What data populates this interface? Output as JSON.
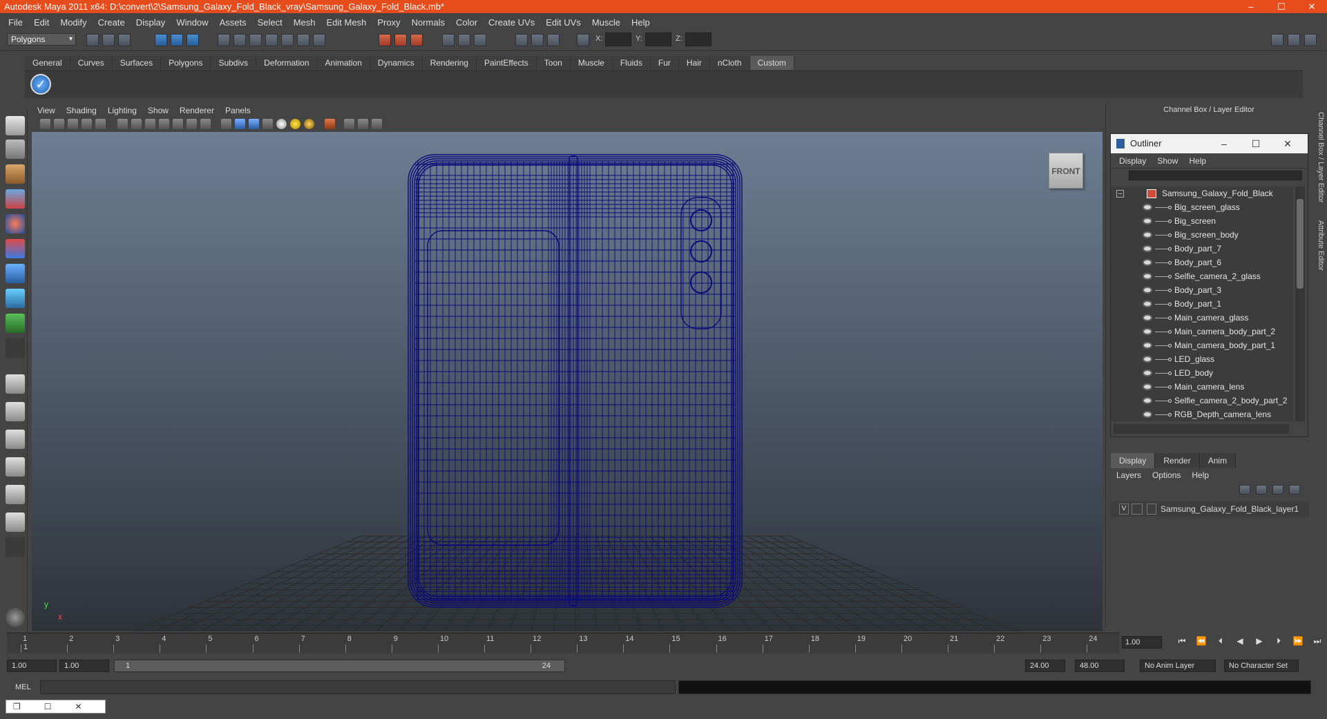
{
  "window": {
    "title": "Autodesk Maya 2011 x64: D:\\convert\\2\\Samsung_Galaxy_Fold_Black_vray\\Samsung_Galaxy_Fold_Black.mb*",
    "controls": [
      "–",
      "☐",
      "✕"
    ]
  },
  "menubar": [
    "File",
    "Edit",
    "Modify",
    "Create",
    "Display",
    "Window",
    "Assets",
    "Select",
    "Mesh",
    "Edit Mesh",
    "Proxy",
    "Normals",
    "Color",
    "Create UVs",
    "Edit UVs",
    "Muscle",
    "Help"
  ],
  "status": {
    "mode": "Polygons",
    "x_label": "X:",
    "y_label": "Y:",
    "z_label": "Z:"
  },
  "shelf": {
    "tabs": [
      "General",
      "Curves",
      "Surfaces",
      "Polygons",
      "Subdivs",
      "Deformation",
      "Animation",
      "Dynamics",
      "Rendering",
      "PaintEffects",
      "Toon",
      "Muscle",
      "Fluids",
      "Fur",
      "Hair",
      "nCloth",
      "Custom"
    ],
    "active": "Custom"
  },
  "viewport": {
    "menu": [
      "View",
      "Shading",
      "Lighting",
      "Show",
      "Renderer",
      "Panels"
    ],
    "cube_label": "FRONT",
    "axis_y": "y",
    "axis_x": "x",
    "wire_color": "#0a0a7a"
  },
  "channel_box": {
    "title": "Channel Box / Layer Editor",
    "side_tabs": [
      "Channel Box / Layer Editor",
      "Attribute Editor"
    ]
  },
  "outliner": {
    "title": "Outliner",
    "window_controls": [
      "–",
      "☐",
      "✕"
    ],
    "menu": [
      "Display",
      "Show",
      "Help"
    ],
    "root": "Samsung_Galaxy_Fold_Black",
    "items": [
      "Big_screen_glass",
      "Big_screen",
      "Big_screen_body",
      "Body_part_7",
      "Body_part_6",
      "Selfie_camera_2_glass",
      "Body_part_3",
      "Body_part_1",
      "Main_camera_glass",
      "Main_camera_body_part_2",
      "Main_camera_body_part_1",
      "LED_glass",
      "LED_body",
      "Main_camera_lens",
      "Selfie_camera_2_body_part_2",
      "RGB_Depth_camera_lens"
    ]
  },
  "layer_editor": {
    "tabs": [
      "Display",
      "Render",
      "Anim"
    ],
    "active": "Display",
    "menu": [
      "Layers",
      "Options",
      "Help"
    ],
    "layer_name": "Samsung_Galaxy_Fold_Black_layer1",
    "layer_visible": "V"
  },
  "timeline": {
    "ticks": [
      "1",
      "2",
      "3",
      "4",
      "5",
      "6",
      "7",
      "8",
      "9",
      "10",
      "11",
      "12",
      "13",
      "14",
      "15",
      "16",
      "17",
      "18",
      "19",
      "20",
      "21",
      "22",
      "23",
      "24"
    ],
    "current_frame": "1.00",
    "current_marker": "1"
  },
  "range": {
    "start": "1.00",
    "inner_start": "1.00",
    "slider_start": "1",
    "slider_end": "24",
    "end": "24.00",
    "outer_end": "48.00",
    "anim_layer": "No Anim Layer",
    "character_set": "No Character Set"
  },
  "mel": {
    "label": "MEL"
  }
}
